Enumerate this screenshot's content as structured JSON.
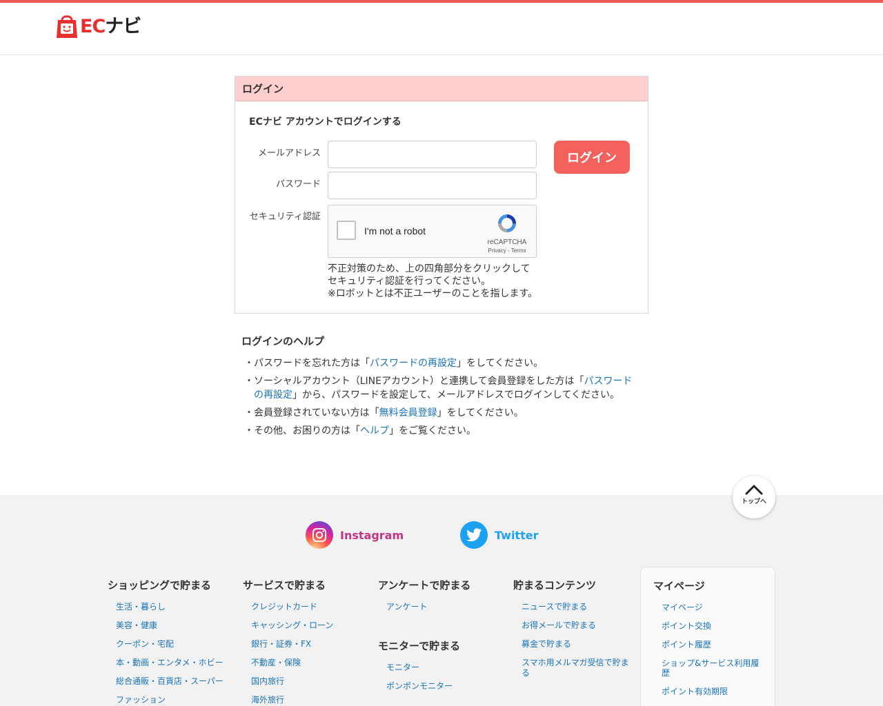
{
  "header": {
    "logo_ec": "EC",
    "logo_navi": "ナビ"
  },
  "login": {
    "heading": "ログイン",
    "account_title": "ECナビ アカウントでログインする",
    "email_label": "メールアドレス",
    "email_value": "",
    "password_label": "パスワード",
    "password_value": "",
    "security_label": "セキュリティ認証",
    "button": "ログイン",
    "captcha": {
      "text": "I'm not a robot",
      "brand": "reCAPTCHA",
      "links": "Privacy - Terms"
    },
    "note_lines": [
      "不正対策のため、上の四角部分をクリックして",
      "セキュリティ認証を行ってください。",
      "※ロボットとは不正ユーザーのことを指します。"
    ]
  },
  "help": {
    "title": "ログインのヘルプ",
    "item1": {
      "pre": "パスワードを忘れた方は「",
      "link": "パスワードの再設定",
      "post": "」をしてください。"
    },
    "item2": {
      "pre": "ソーシャルアカウント（LINEアカウント）と連携して会員登録をした方は「",
      "link": "パスワードの再設定",
      "post": "」から、パスワードを設定して、メールアドレスでログインしてください。"
    },
    "item3": {
      "pre": "会員登録されていない方は「",
      "link": "無料会員登録",
      "post": "」をしてください。"
    },
    "item4": {
      "pre": "その他、お困りの方は「",
      "link": "ヘルプ",
      "post": "」をご覧ください。"
    }
  },
  "pagetop": {
    "label": "トップへ"
  },
  "footer": {
    "instagram": "Instagram",
    "twitter": "Twitter",
    "colors": {
      "instagram": "#c13584",
      "twitter": "#1da1f2"
    },
    "col1": {
      "title": "ショッピングで貯まる",
      "items": [
        "生活・暮らし",
        "美容・健康",
        "クーポン・宅配",
        "本・動画・エンタメ・ホビー",
        "総合通販・百貨店・スーパー",
        "ファッション"
      ]
    },
    "col2": {
      "title": "サービスで貯まる",
      "items": [
        "クレジットカード",
        "キャッシング・ローン",
        "銀行・証券・FX",
        "不動産・保険",
        "国内旅行",
        "海外旅行"
      ]
    },
    "col3": {
      "title": "アンケートで貯まる",
      "items": [
        "アンケート"
      ]
    },
    "col3b": {
      "title": "モニターで貯まる",
      "items": [
        "モニター",
        "ポンポンモニター"
      ]
    },
    "col4": {
      "title": "貯まるコンテンツ",
      "items": [
        "ニュースで貯まる",
        "お得メールで貯まる",
        "募金で貯まる",
        "スマホ用メルマガ受信で貯まる"
      ]
    },
    "mypage": {
      "title": "マイページ",
      "items": [
        "マイページ",
        "ポイント交換",
        "ポイント履歴",
        "ショップ&サービス利用履歴",
        "ポイント有効期限"
      ]
    }
  },
  "accent_color": "#f2615c"
}
